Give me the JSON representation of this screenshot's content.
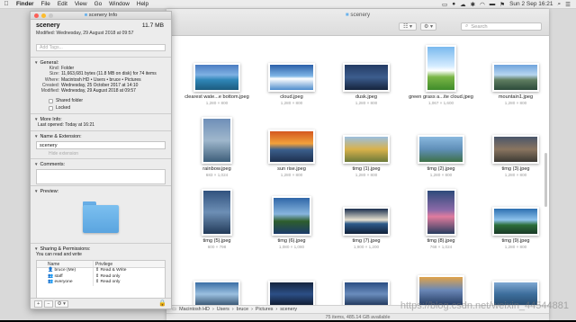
{
  "menubar": {
    "app": "Finder",
    "items": [
      "File",
      "Edit",
      "View",
      "Go",
      "Window",
      "Help"
    ],
    "clock": "Sun 2 Sep 16:21"
  },
  "finder": {
    "title": "scenery",
    "search_placeholder": "Search",
    "path": [
      "Macintosh HD",
      "Users",
      "bruce",
      "Pictures",
      "scenery"
    ],
    "status": "75 items, 485.14 GB available",
    "files": [
      {
        "name": "clearest wate...e bottom.jpeg",
        "dims": "1,280 × 800"
      },
      {
        "name": "cloud.jpeg",
        "dims": "1,280 × 800"
      },
      {
        "name": "dusk.jpeg",
        "dims": "1,280 × 800"
      },
      {
        "name": "green grass a...ite cloud.jpeg",
        "dims": "1,067 × 1,600"
      },
      {
        "name": "mountain1.jpeg",
        "dims": "1,280 × 800"
      },
      {
        "name": "rainbow.jpeg",
        "dims": "683 × 1,024"
      },
      {
        "name": "sun rise.jpeg",
        "dims": "1,280 × 800"
      },
      {
        "name": "timg (1).jpeg",
        "dims": "1,280 × 800"
      },
      {
        "name": "timg (2).jpeg",
        "dims": "1,280 × 800"
      },
      {
        "name": "timg (3).jpeg",
        "dims": "1,280 × 800"
      },
      {
        "name": "timg (5).jpeg",
        "dims": "600 × 798"
      },
      {
        "name": "timg (6).jpeg",
        "dims": "1,080 × 1,080"
      },
      {
        "name": "timg (7).jpeg",
        "dims": "1,900 × 1,200"
      },
      {
        "name": "timg (8).jpeg",
        "dims": "768 × 1,024"
      },
      {
        "name": "timg (9).jpeg",
        "dims": "1,280 × 800"
      },
      {
        "name": "",
        "dims": ""
      },
      {
        "name": "",
        "dims": ""
      },
      {
        "name": "",
        "dims": ""
      },
      {
        "name": "",
        "dims": ""
      },
      {
        "name": "",
        "dims": ""
      }
    ]
  },
  "info": {
    "window_title": "scenery Info",
    "name": "scenery",
    "size_short": "11.7 MB",
    "modified_line": "Modified: Wednesday, 29 August 2018 at 09:57",
    "tags_placeholder": "Add Tags...",
    "general": {
      "header": "General:",
      "kind_k": "Kind:",
      "kind_v": "Folder",
      "size_k": "Size:",
      "size_v": "11,663,681 bytes (11.8 MB on disk) for 74 items",
      "where_k": "Where:",
      "where_v": "Macintosh HD • Users • bruce • Pictures",
      "created_k": "Created:",
      "created_v": "Wednesday, 25 October 2017 at 14:10",
      "modified_k": "Modified:",
      "modified_v": "Wednesday, 29 August 2018 at 09:57",
      "shared": "Shared folder",
      "locked": "Locked"
    },
    "more_info": {
      "header": "More Info:",
      "last_opened": "Last opened: Today at 16:21"
    },
    "name_ext": {
      "header": "Name & Extension:",
      "value": "scenery",
      "hide": "Hide extension"
    },
    "comments": {
      "header": "Comments:"
    },
    "preview": {
      "header": "Preview:"
    },
    "sharing": {
      "header": "Sharing & Permissions:",
      "note": "You can read and write",
      "col_name": "Name",
      "col_priv": "Privilege",
      "rows": [
        {
          "name": "bruce (Me)",
          "priv": "Read & Write"
        },
        {
          "name": "staff",
          "priv": "Read only"
        },
        {
          "name": "everyone",
          "priv": "Read only"
        }
      ]
    },
    "footer": {
      "add": "+",
      "remove": "−",
      "gear": "⚙ ▾"
    }
  },
  "watermark": "https://blog.csdn.net/weixin_44544881",
  "colors": {
    "accent": "#2f7bd9",
    "folder": "#6bb3ec"
  }
}
